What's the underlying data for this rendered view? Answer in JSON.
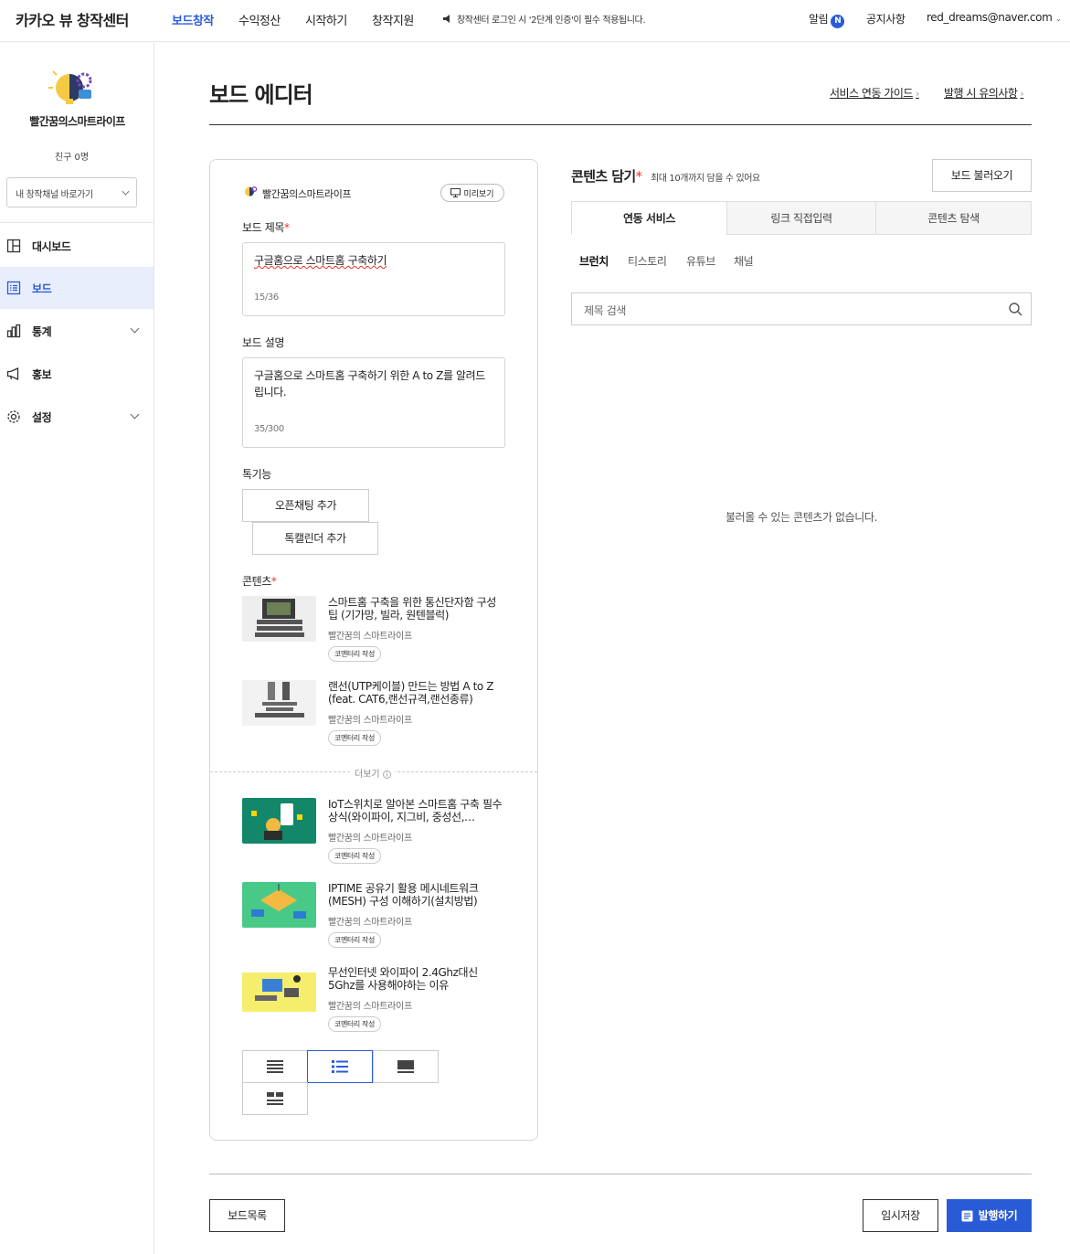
{
  "header": {
    "logo": "카카오 뷰 창작센터",
    "nav": [
      "보드창작",
      "수익정산",
      "시작하기",
      "창작지원"
    ],
    "notice": "창작센터 로그인 시 '2단계 인증'이 필수 적용됩니다.",
    "alarm_label": "알림",
    "alarm_badge": "N",
    "notice_link": "공지사항",
    "account": "red_dreams@naver.com"
  },
  "sidebar": {
    "profile_name": "빨간꿈의스마트라이프",
    "friends": "친구 0명",
    "channel_select": "내 창작채널 바로가기",
    "items": [
      {
        "label": "대시보드",
        "icon": "dashboard-icon"
      },
      {
        "label": "보드",
        "icon": "board-icon"
      },
      {
        "label": "통계",
        "icon": "stats-icon"
      },
      {
        "label": "홍보",
        "icon": "megaphone-icon"
      },
      {
        "label": "설정",
        "icon": "gear-icon"
      }
    ]
  },
  "page": {
    "title": "보드 에디터",
    "link_guide": "서비스 연동 가이드",
    "link_caution": "발행 시 유의사항"
  },
  "editor": {
    "channel_name": "빨간꿈의스마트라이프",
    "preview": "미리보기",
    "title_label": "보드 제목",
    "title_value": "구글홈으로 스마트홈 구축하기",
    "title_count": "15/36",
    "desc_label": "보드 설명",
    "desc_value": "구글홈으로 스마트홈 구축하기 위한 A to Z를 알려드립니다.",
    "desc_count": "35/300",
    "special_label": "톡기능",
    "openchat_btn": "오픈채팅 추가",
    "calendar_btn": "톡캘린더 추가",
    "contents_label": "콘텐츠",
    "more_label": "더보기",
    "contents": [
      {
        "title": "스마트홈 구축을 위한 통신단자함 구성 팁 (기가망, 빌라, 원텐블럭)",
        "author": "빨간꿈의 스마트라이프",
        "tag": "코멘터리 작성"
      },
      {
        "title": "랜선(UTP케이블) 만드는 방법 A to Z (feat. CAT6,랜선규격,랜선종류)",
        "author": "빨간꿈의 스마트라이프",
        "tag": "코멘터리 작성"
      },
      {
        "title": "IoT스위치로 알아본 스마트홈 구축 필수 상식(와이파이, 지그비, 중성선,…",
        "author": "빨간꿈의 스마트라이프",
        "tag": "코멘터리 작성"
      },
      {
        "title": "IPTIME 공유기 활용 메시네트워크(MESH) 구성 이해하기(설치방법)",
        "author": "빨간꿈의 스마트라이프",
        "tag": "코멘터리 작성"
      },
      {
        "title": "무선인터넷 와이파이 2.4Ghz대신 5Ghz를 사용해야하는 이유",
        "author": "빨간꿈의 스마트라이프",
        "tag": "코멘터리 작성"
      }
    ]
  },
  "right": {
    "title": "콘텐츠 담기",
    "subtitle": "최대 10개까지 담을 수 있어요",
    "load_btn": "보드 불러오기",
    "tabs": [
      "연동 서비스",
      "링크 직접입력",
      "콘텐츠 탐색"
    ],
    "subtabs": [
      "브런치",
      "티스토리",
      "유튜브",
      "채널"
    ],
    "search_placeholder": "제목 검색",
    "empty": "불러올 수 있는 콘텐츠가 없습니다."
  },
  "footer": {
    "list_btn": "보드목록",
    "save_btn": "임시저장",
    "publish_btn": "발행하기"
  },
  "colors": {
    "accent": "#2a5bd7",
    "required": "#e5322d"
  }
}
